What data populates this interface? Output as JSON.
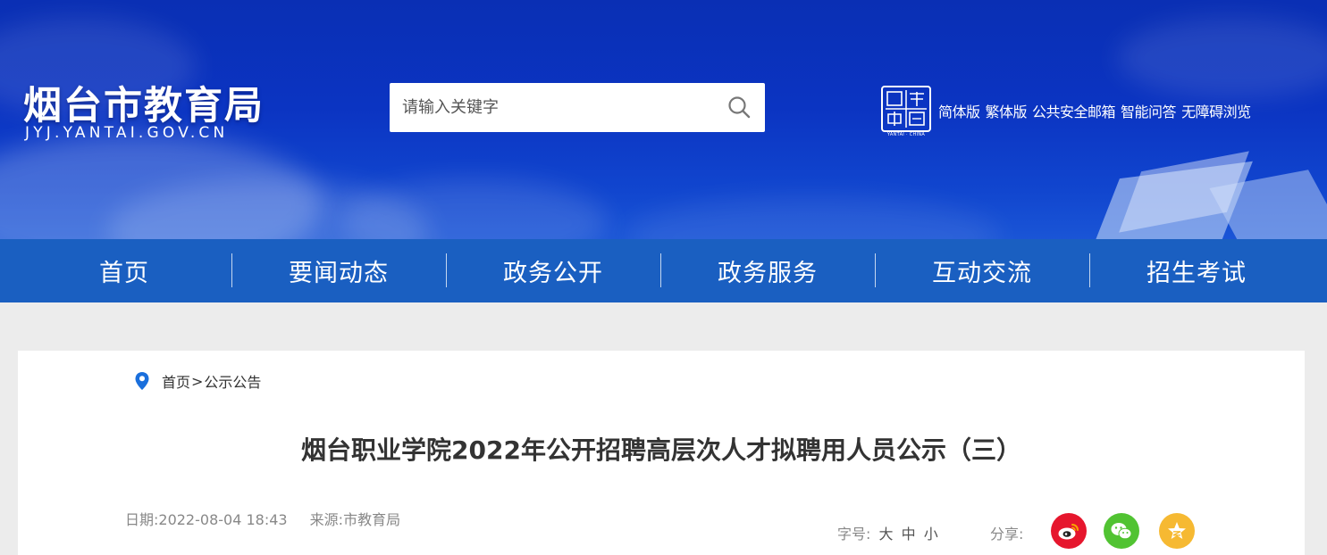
{
  "header": {
    "site_name": "烟台市教育局",
    "domain": "JYJ.YANTAI.GOV.CN",
    "seal_text": "YANTAI · CHINA"
  },
  "search": {
    "placeholder": "请输入关键字",
    "icon": "search-icon"
  },
  "top_links": [
    "简体版",
    "繁体版",
    "公共安全邮箱",
    "智能问答",
    "无障碍浏览"
  ],
  "nav": [
    "首页",
    "要闻动态",
    "政务公开",
    "政务服务",
    "互动交流",
    "招生考试"
  ],
  "breadcrumb": {
    "icon": "location-pin-icon",
    "home": "首页",
    "separator": ">",
    "current": "公示公告"
  },
  "article": {
    "title": "烟台职业学院2022年公开招聘高层次人才拟聘用人员公示（三）",
    "date": "日期:2022-08-04 18:43",
    "source": "来源:市教育局"
  },
  "toolbar": {
    "font_label": "字号:",
    "font_large": "大",
    "font_medium": "中",
    "font_small": "小",
    "share_label": "分享:",
    "share_targets": [
      {
        "name": "weibo",
        "icon": "weibo-icon",
        "color": "#e6162d"
      },
      {
        "name": "wechat",
        "icon": "wechat-icon",
        "color": "#51c332"
      },
      {
        "name": "qzone",
        "icon": "qzone-star-icon",
        "color": "#f6b932"
      }
    ]
  },
  "colors": {
    "nav_bg": "#1a5fc1",
    "banner_bg": "#0b34c2",
    "page_bg": "#ececec",
    "pin": "#1a6fdc"
  }
}
